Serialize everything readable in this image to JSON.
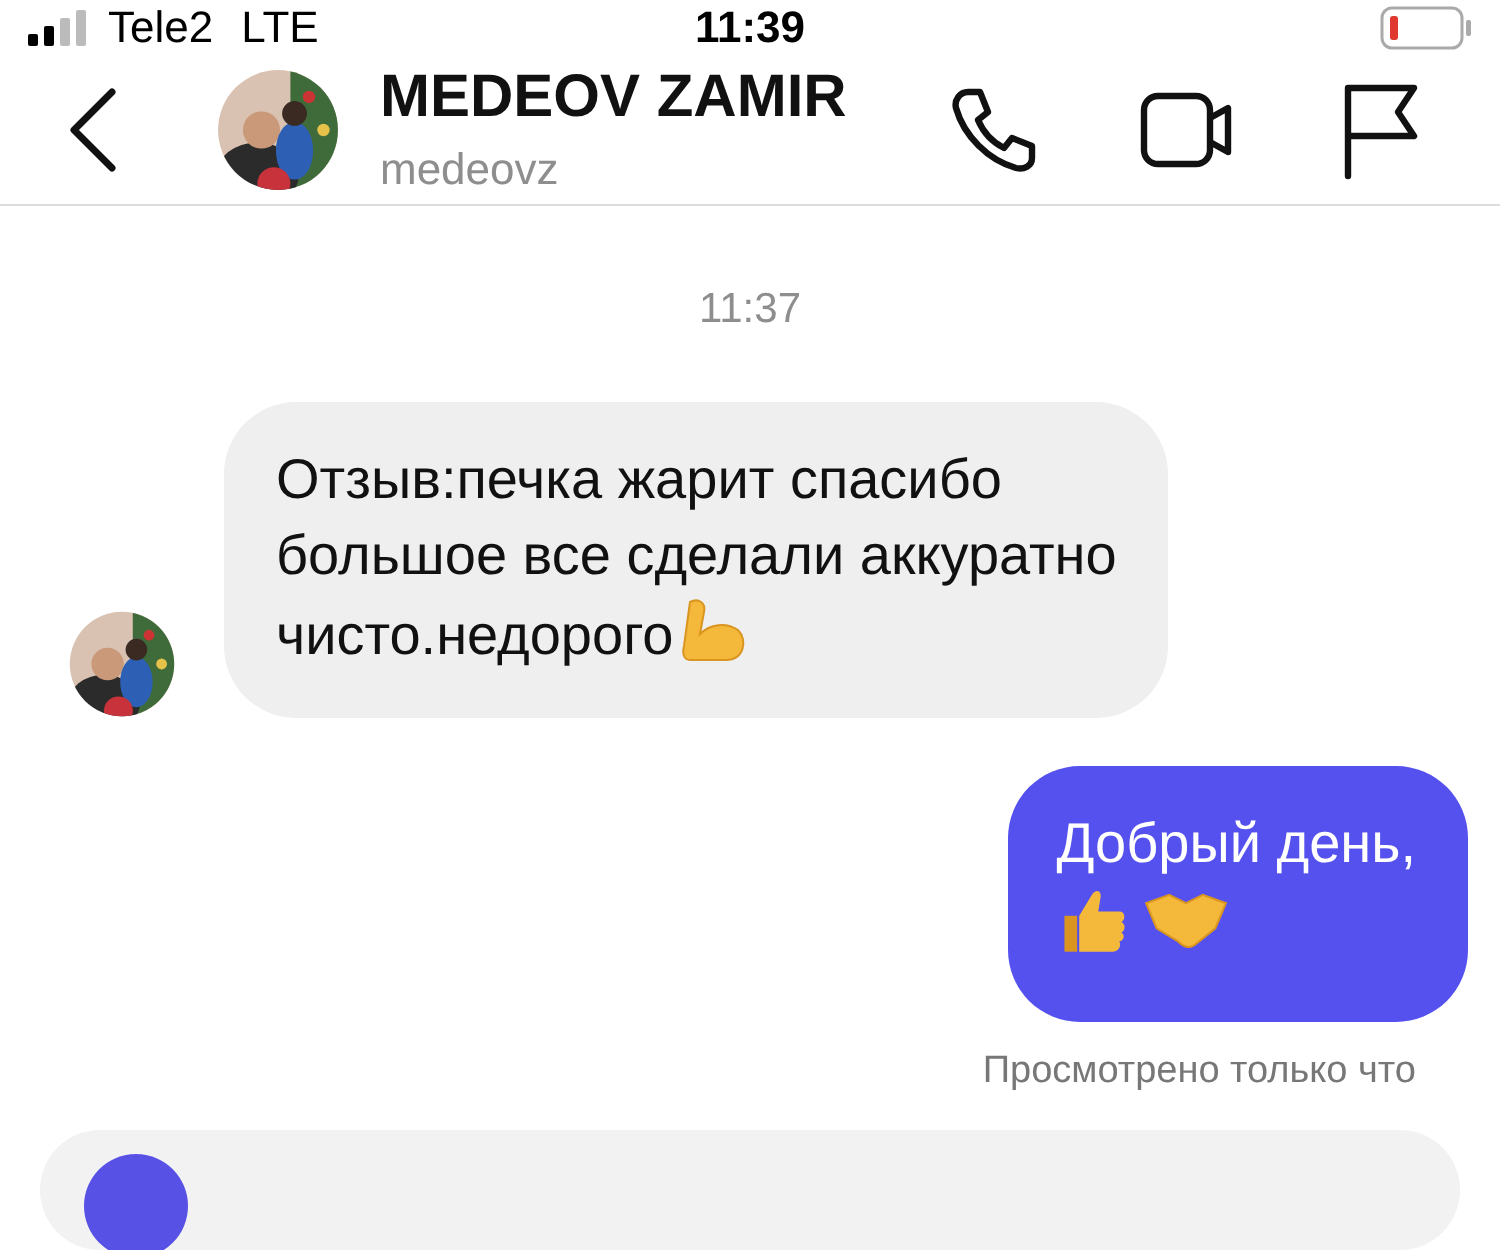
{
  "status_bar": {
    "carrier": "Tele2",
    "network": "LTE",
    "time": "11:39"
  },
  "header": {
    "name": "MEDEOV ZAMIR",
    "username": "medeovz"
  },
  "timestamp": "11:37",
  "messages": [
    {
      "kind": "incoming",
      "lines": [
        "Отзыв:печка жарит спасибо",
        "большое все сделали аккуратно",
        "чисто.недорого"
      ],
      "emojis": [
        {
          "kind": "biceps"
        }
      ]
    },
    {
      "kind": "outgoing",
      "lines": [
        "Добрый день,"
      ],
      "emojis": [
        {
          "kind": "thumbs"
        },
        {
          "kind": "handshake"
        }
      ]
    }
  ],
  "seen": "Просмотрено только что"
}
